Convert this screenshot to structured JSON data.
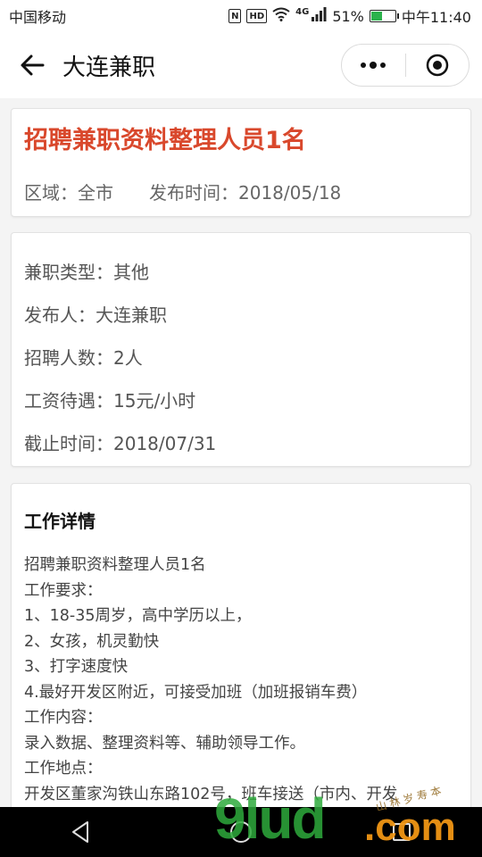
{
  "status_bar": {
    "carrier": "中国移动",
    "nfc": "N",
    "hd": "HD",
    "network": "4G",
    "battery_percent": "51%",
    "battery_level": 0.51,
    "time": "中午11:40"
  },
  "nav": {
    "title": "大连兼职"
  },
  "job": {
    "title": "招聘兼职资料整理人员1名",
    "region": "区域：全市",
    "publish_time": "发布时间：2018/05/18"
  },
  "info": {
    "type": "兼职类型：其他",
    "publisher": "发布人：大连兼职",
    "headcount": "招聘人数：2人",
    "salary": "工资待遇：15元/小时",
    "deadline": "截止时间：2018/07/31"
  },
  "details": {
    "section_title": "工作详情",
    "lines": [
      "招聘兼职资料整理人员1名",
      "工作要求：",
      "1、18-35周岁，高中学历以上，",
      "2、女孩，机灵勤快",
      "3、打字速度快",
      "4.最好开发区附近，可接受加班（加班报销车费）",
      "工作内容：",
      "录入数据、整理资料等、辅助领导工作。",
      "工作地点：",
      "开发区董家沟铁山东路102号，班车接送（市内、开发"
    ]
  },
  "watermark": {
    "main": "9lud",
    "suffix": ".com",
    "small": "山 林 岁 寿 本"
  },
  "colors": {
    "accent_red": "#d9482c",
    "battery_green": "#2bb24c"
  }
}
